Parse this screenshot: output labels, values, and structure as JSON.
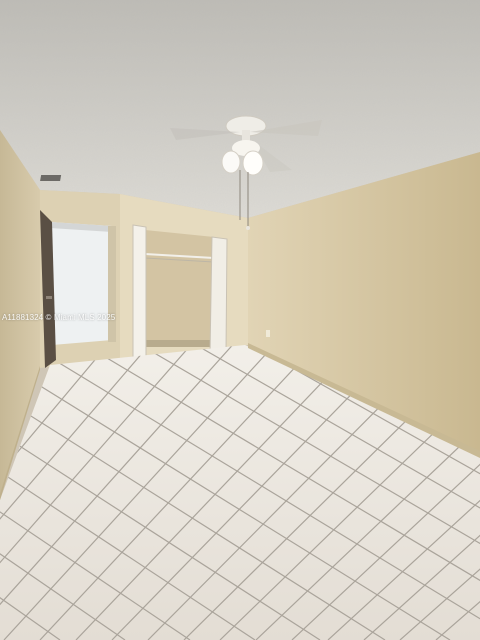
{
  "photo": {
    "watermark_text": "A11881324 © Miami MLS 2025",
    "colors": {
      "ceiling": "#d9d7d0",
      "wall_right": "#d8c8a6",
      "wall_left": "#cfc1a3",
      "back_wall": "#e7dcc0",
      "floor_tile": "#eeeae4",
      "grout": "#a9a39a",
      "baseboard": "#cdbfa2"
    },
    "fixtures": [
      "ceiling-fan",
      "closet-with-bifold-doors",
      "open-doorway",
      "tile-floor",
      "air-vent"
    ]
  }
}
